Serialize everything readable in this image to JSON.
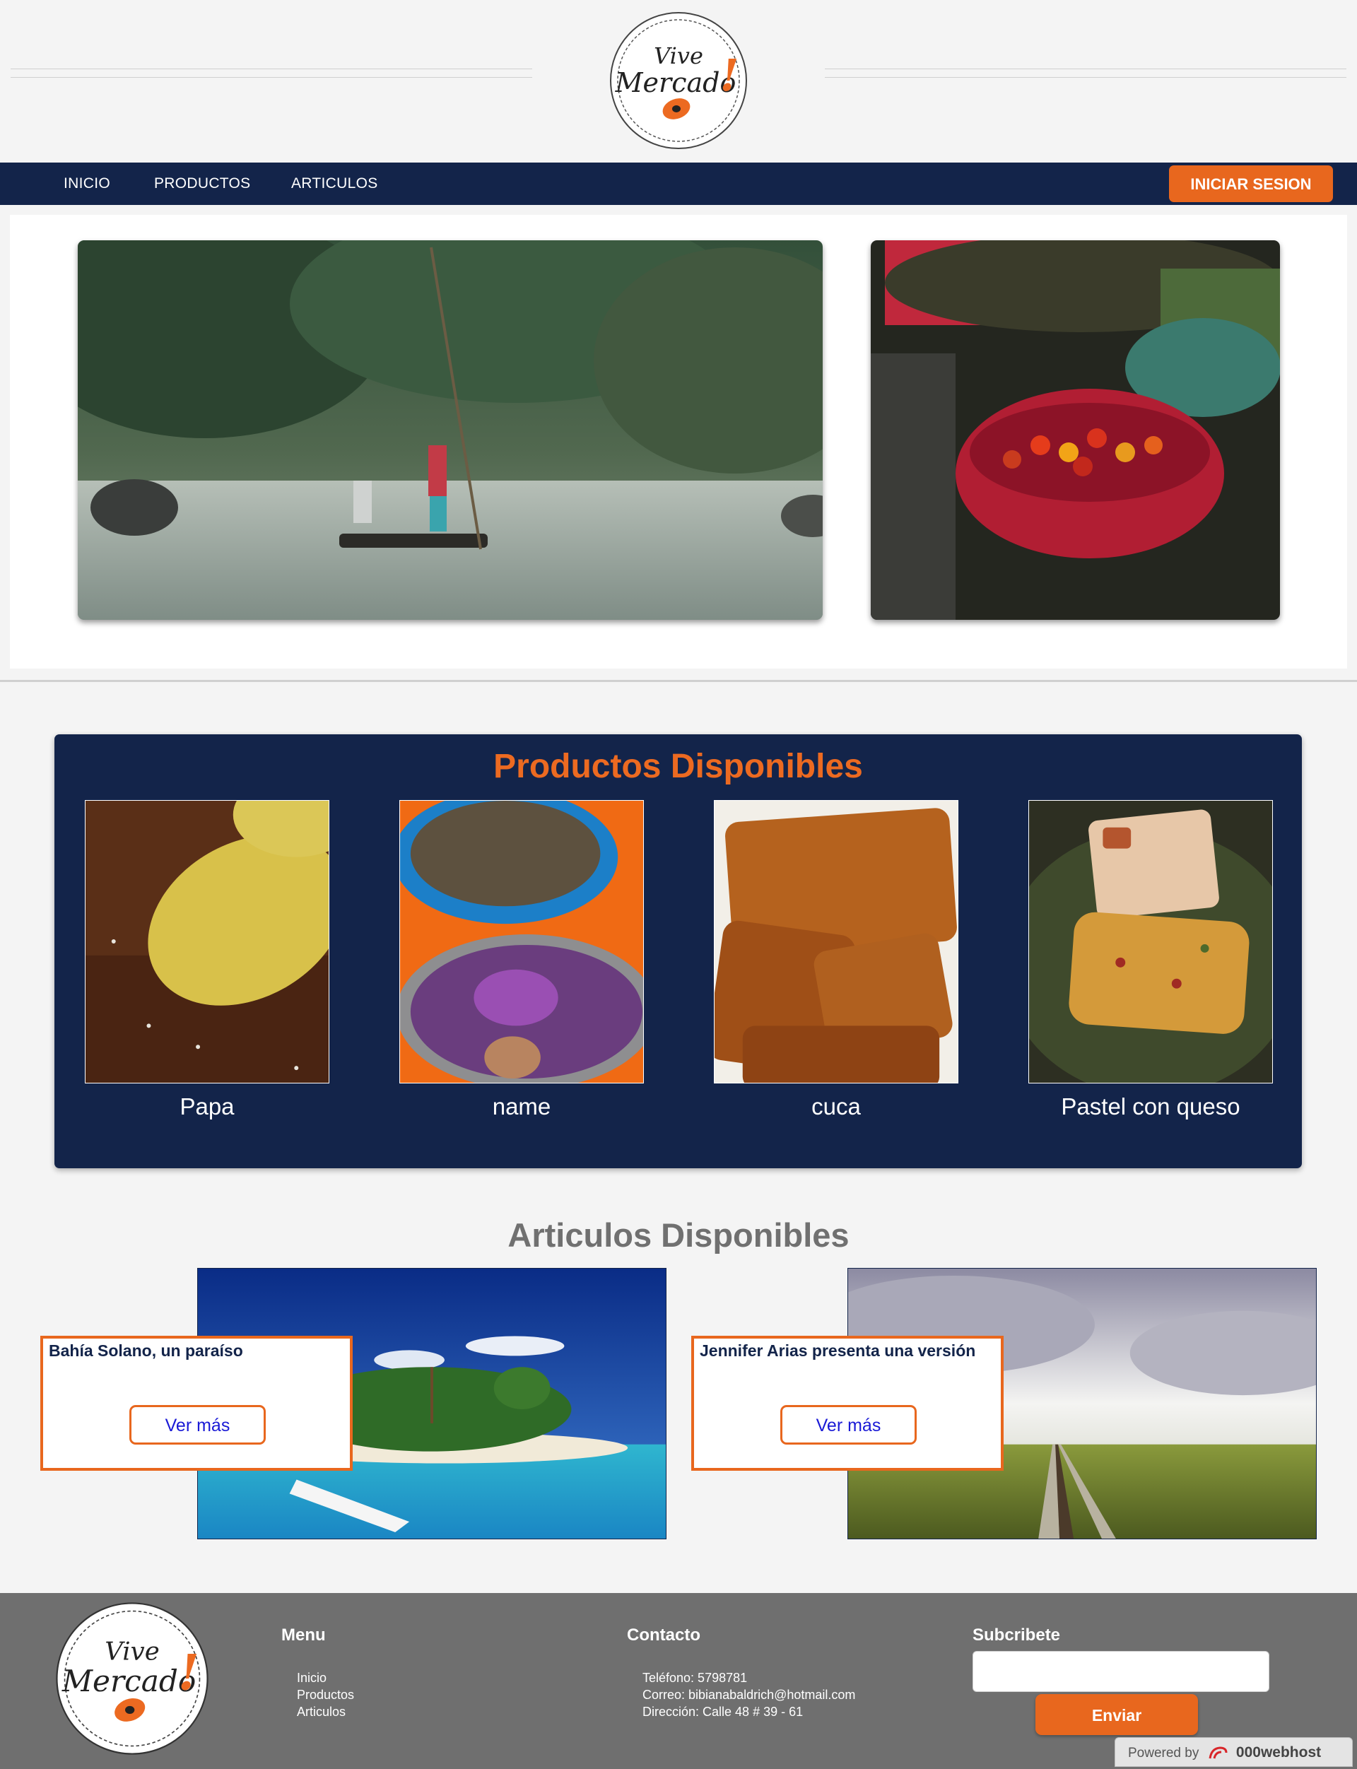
{
  "logo": {
    "line1": "Vive",
    "line2": "Mercado",
    "mark": "!",
    "icon": "papaya-icon"
  },
  "nav": {
    "items": [
      {
        "label": "INICIO"
      },
      {
        "label": "PRODUCTOS"
      },
      {
        "label": "ARTICULOS"
      }
    ],
    "login_label": "INICIAR SESION"
  },
  "hero": {
    "images": [
      "river-canoe-photo",
      "fruit-market-photo"
    ]
  },
  "productos": {
    "title": "Productos Disponibles",
    "items": [
      {
        "name": "Papa"
      },
      {
        "name": "name"
      },
      {
        "name": "cuca"
      },
      {
        "name": "Pastel con queso"
      }
    ]
  },
  "articulos": {
    "title": "Articulos Disponibles",
    "items": [
      {
        "title": "Bahía Solano, un paraíso",
        "button": "Ver más"
      },
      {
        "title": "Jennifer Arias presenta una versión",
        "button": "Ver más"
      }
    ]
  },
  "footer": {
    "menu": {
      "heading": "Menu",
      "items": [
        "Inicio",
        "Productos",
        "Articulos"
      ]
    },
    "contacto": {
      "heading": "Contacto",
      "telefono": "Teléfono: 5798781",
      "correo": "Correo: bibianabaldrich@hotmail.com",
      "direccion": "Dirección: Calle 48 # 39 - 61"
    },
    "subscribe": {
      "heading": "Subcribete",
      "input_value": "",
      "button": "Enviar"
    },
    "powered": {
      "prefix": "Powered by",
      "brand": "000webhost"
    }
  },
  "colors": {
    "navy": "#13244a",
    "orange": "#e8671e",
    "background": "#f4f4f4",
    "footer": "#6f6f6f"
  }
}
